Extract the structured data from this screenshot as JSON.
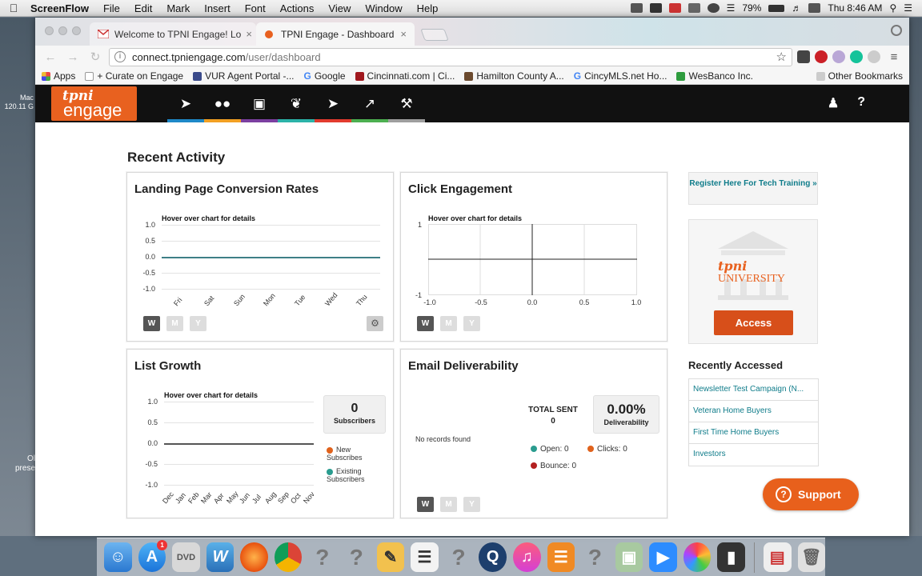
{
  "menubar": {
    "app": "ScreenFlow",
    "items": [
      "File",
      "Edit",
      "Mark",
      "Insert",
      "Font",
      "Actions",
      "View",
      "Window",
      "Help"
    ],
    "battery": "79%",
    "clock": "Thu 8:46 AM"
  },
  "desktop": {
    "left_top": "Mac",
    "left_top2": "120.11 G",
    "left_bottom": "Ol",
    "left_bottom2": "prese"
  },
  "browser": {
    "tabs": [
      {
        "label": "Welcome to TPNI Engage! Lo"
      },
      {
        "label": "TPNI Engage - Dashboard"
      }
    ],
    "url_host": "connect.tpniengage.com",
    "url_path": "/user/dashboard",
    "bookmarks": [
      "Apps",
      "+ Curate on Engage",
      "VUR Agent Portal -...",
      "Google",
      "Cincinnati.com | Ci...",
      "Hamilton County A...",
      "CincyMLS.net Ho...",
      "WesBanco Inc."
    ],
    "other_bookmarks": "Other Bookmarks"
  },
  "app": {
    "logo_top": "tpni",
    "logo_bottom": "engage",
    "nav_colors": [
      "#1e88c7",
      "#f2a023",
      "#7b3fa0",
      "#2bb2a8",
      "#e23b2e",
      "#4caf50",
      "#9e9e9e"
    ]
  },
  "dashboard": {
    "heading": "Recent Activity",
    "landing": {
      "title": "Landing Page Conversion Rates",
      "hover": "Hover over chart for details",
      "yticks": [
        "1.0",
        "0.5",
        "0.0",
        "-0.5",
        "-1.0"
      ],
      "days": [
        "Fri",
        "Sat",
        "Sun",
        "Mon",
        "Tue",
        "Wed",
        "Thu"
      ],
      "buttons": [
        "W",
        "M",
        "Y"
      ]
    },
    "click": {
      "title": "Click Engagement",
      "hover": "Hover over chart for details",
      "ytop": "1",
      "ybottom": "-1",
      "xticks": [
        "-1.0",
        "-0.5",
        "0.0",
        "0.5",
        "1.0"
      ],
      "buttons": [
        "W",
        "M",
        "Y"
      ]
    },
    "list": {
      "title": "List Growth",
      "hover": "Hover over chart for details",
      "yticks": [
        "1.0",
        "0.5",
        "0.0",
        "-0.5",
        "-1.0"
      ],
      "months": [
        "Dec",
        "Jan",
        "Feb",
        "Mar",
        "Apr",
        "May",
        "Jun",
        "Jul",
        "Aug",
        "Sep",
        "Oct",
        "Nov"
      ],
      "subscribers_num": "0",
      "subscribers_lbl": "Subscribers",
      "legend_new": "New Subscribes",
      "legend_existing": "Existing Subscribers"
    },
    "email": {
      "title": "Email Deliverability",
      "no_records": "No records found",
      "total_sent_lbl": "TOTAL SENT",
      "total_sent": "0",
      "pct": "0.00%",
      "pct_lbl": "Deliverability",
      "open": "Open: 0",
      "clicks": "Clicks: 0",
      "bounce": "Bounce: 0",
      "buttons": [
        "W",
        "M",
        "Y"
      ]
    },
    "register": "Register Here For Tech Training »",
    "university_top": "tpni",
    "university_bottom": "UNIVERSITY",
    "access": "Access",
    "recently_heading": "Recently Accessed",
    "recent": [
      "Newsletter Test Campaign (N...",
      "Veteran Home Buyers",
      "First Time Home Buyers",
      "Investors"
    ],
    "support": "Support"
  },
  "colors": {
    "brand": "#e8611f",
    "teal": "#0f7c8a",
    "chart_line": "#3e7f86",
    "legend_new": "#e0621c",
    "legend_existing": "#2a9c8f",
    "bounce": "#b32020"
  }
}
